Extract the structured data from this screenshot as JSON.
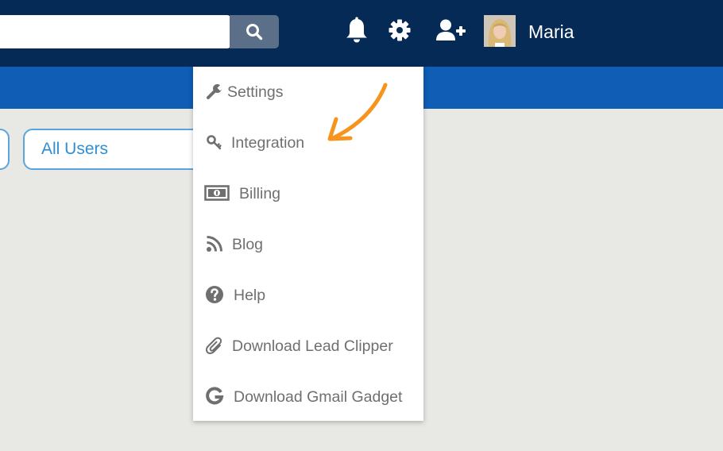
{
  "header": {
    "search": {
      "value": "",
      "placeholder": ""
    },
    "icons": [
      "search-icon",
      "bell-icon",
      "gear-icon",
      "add-user-icon"
    ],
    "user": {
      "name": "Maria"
    },
    "colors": {
      "topbar": "#052a55",
      "subbar": "#0f5db5",
      "search_button": "#5b7088"
    }
  },
  "filters": {
    "all_users_label": "All Users"
  },
  "dropdown": {
    "items": [
      {
        "label": "Settings",
        "icon": "wrench-icon"
      },
      {
        "label": "Integration",
        "icon": "key-icon"
      },
      {
        "label": "Billing",
        "icon": "money-icon"
      },
      {
        "label": "Blog",
        "icon": "rss-icon"
      },
      {
        "label": "Help",
        "icon": "question-circle-icon"
      },
      {
        "label": "Download Lead Clipper",
        "icon": "paperclip-icon"
      },
      {
        "label": "Download Gmail Gadget",
        "icon": "google-icon"
      }
    ]
  },
  "annotation": {
    "color": "#f7941d",
    "points_to": "Integration"
  }
}
